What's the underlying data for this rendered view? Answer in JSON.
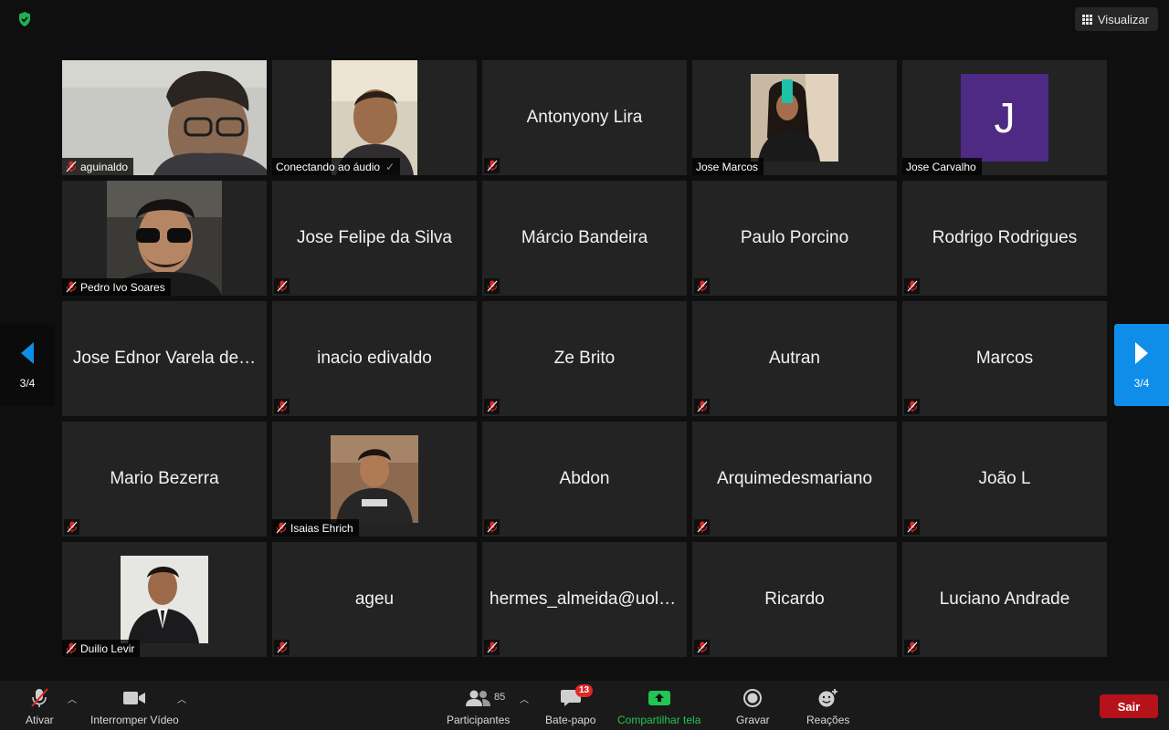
{
  "top": {
    "view_label": "Visualizar"
  },
  "paging": {
    "left_indicator": "3/4",
    "right_indicator": "3/4"
  },
  "tiles": [
    {
      "name": "aguinaldo",
      "type": "video",
      "photo": "p1"
    },
    {
      "name": "Conectando ao áudio",
      "type": "video",
      "photo": "p2",
      "check": "✓"
    },
    {
      "name": "Antonyony Lira",
      "type": "text"
    },
    {
      "name": "Jose Marcos",
      "type": "video",
      "photo": "p3"
    },
    {
      "name": "Jose Carvalho",
      "type": "avatar",
      "initial": "J"
    },
    {
      "name": "Pedro Ivo Soares",
      "type": "video",
      "photo": "p4"
    },
    {
      "name": "Jose Felipe da Silva",
      "type": "text"
    },
    {
      "name": "Márcio Bandeira",
      "type": "text"
    },
    {
      "name": "Paulo Porcino",
      "type": "text"
    },
    {
      "name": "Rodrigo Rodrigues",
      "type": "text"
    },
    {
      "name": "Jose Ednor Varela de…",
      "type": "text",
      "mic": false
    },
    {
      "name": "inacio edivaldo",
      "type": "text"
    },
    {
      "name": "Ze Brito",
      "type": "text"
    },
    {
      "name": "Autran",
      "type": "text"
    },
    {
      "name": "Marcos",
      "type": "text"
    },
    {
      "name": "Mario Bezerra",
      "type": "text"
    },
    {
      "name": "Isaias Ehrich",
      "type": "video",
      "photo": "p5"
    },
    {
      "name": "Abdon",
      "type": "text"
    },
    {
      "name": "Arquimedesmariano",
      "type": "text"
    },
    {
      "name": "João L",
      "type": "text"
    },
    {
      "name": "Duilio Levir",
      "type": "video",
      "photo": "p6"
    },
    {
      "name": "ageu",
      "type": "text"
    },
    {
      "name": "hermes_almeida@uol.…",
      "type": "text"
    },
    {
      "name": "Ricardo",
      "type": "text"
    },
    {
      "name": "Luciano Andrade",
      "type": "text"
    }
  ],
  "toolbar": {
    "mute_label": "Ativar",
    "video_label": "Interromper Vídeo",
    "participants_label": "Participantes",
    "participants_count": "85",
    "chat_label": "Bate-papo",
    "chat_badge": "13",
    "share_label": "Compartilhar tela",
    "record_label": "Gravar",
    "reactions_label": "Reações",
    "leave_label": "Sair"
  },
  "colors": {
    "accent": "#0e8ee9",
    "leave": "#b5121b",
    "share": "#23c552",
    "avatar": "#4e2a84"
  }
}
